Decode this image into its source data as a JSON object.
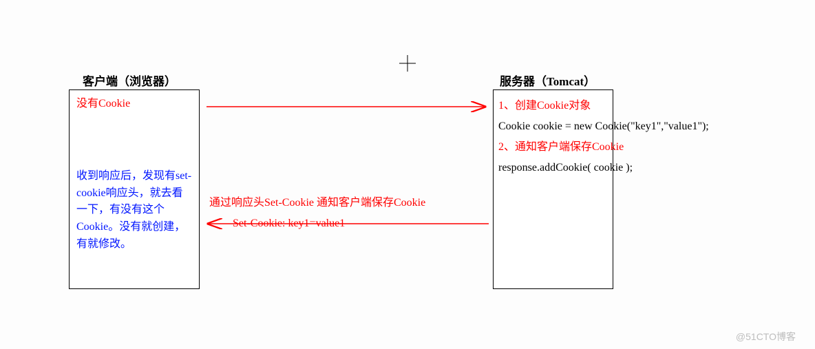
{
  "client": {
    "title": "客户端（浏览器）",
    "noCookie": "没有Cookie",
    "responseNote": "收到响应后，发现有set-cookie响应头，就去看一下，有没有这个Cookie。没有就创建，有就修改。"
  },
  "server": {
    "title": "服务器（Tomcat）",
    "step1": "1、创建Cookie对象",
    "code1": "Cookie cookie = new Cookie(\"key1\",\"value1\");",
    "step2": "2、通知客户端保存Cookie",
    "code2": "response.addCookie( cookie );"
  },
  "arrows": {
    "responseHeaderNote": "通过响应头Set-Cookie 通知客户端保存Cookie",
    "setCookieHeader": "Set-Cookie: key1=value1"
  },
  "watermark": "@51CTO博客",
  "colors": {
    "red": "#ff0000",
    "blue": "#0015ff"
  }
}
